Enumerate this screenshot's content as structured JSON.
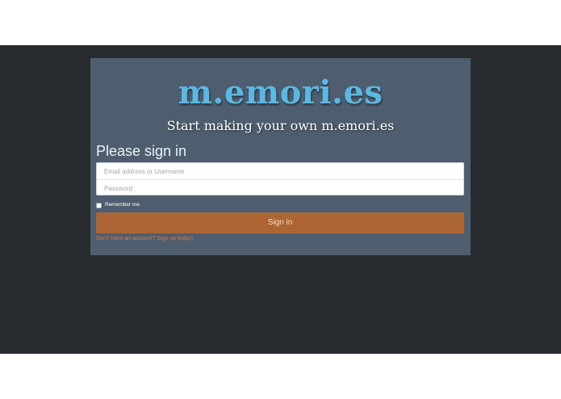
{
  "brand": {
    "logo_text": "m.emori.es",
    "tagline": "Start making your own m.emori.es"
  },
  "login": {
    "heading": "Please sign in",
    "username_placeholder": "Email address or Username",
    "password_placeholder": "Password",
    "remember_label": "Remember me",
    "remember_checked": false,
    "submit_label": "Sign in",
    "signup_link": "Don't have an account? Sign up today!"
  },
  "colors": {
    "page_background": "#282b30",
    "card_background": "#4e5e6e",
    "logo": "#5bb8e4",
    "button": "#ad6535",
    "link": "#d9783d"
  }
}
